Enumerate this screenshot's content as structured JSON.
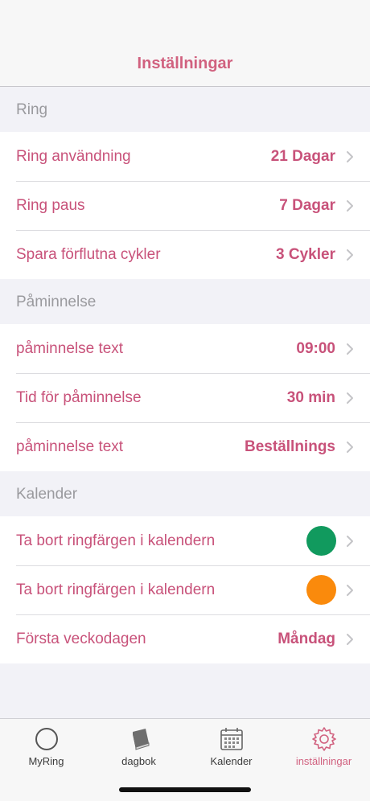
{
  "nav": {
    "title": "Inställningar"
  },
  "sections": {
    "ring": {
      "header": "Ring",
      "rows": [
        {
          "label": "Ring användning",
          "value": "21 Dagar"
        },
        {
          "label": "Ring paus",
          "value": "7 Dagar"
        },
        {
          "label": "Spara förflutna cykler",
          "value": "3 Cykler"
        }
      ]
    },
    "reminder": {
      "header": "Påminnelse",
      "rows": [
        {
          "label": "påminnelse text",
          "value": "09:00"
        },
        {
          "label": "Tid för påminnelse",
          "value": "30 min"
        },
        {
          "label": "påminnelse text",
          "value": "Beställnings"
        }
      ]
    },
    "calendar": {
      "header": "Kalender",
      "rows": [
        {
          "label": "Ta bort ringfärgen i kalendern",
          "color": "#119a5e"
        },
        {
          "label": "Ta bort ringfärgen i kalendern",
          "color": "#fa8a0c"
        },
        {
          "label": "Första veckodagen",
          "value": "Måndag"
        }
      ]
    }
  },
  "tabbar": {
    "tabs": [
      {
        "label": "MyRing",
        "icon": "ring-icon"
      },
      {
        "label": "dagbok",
        "icon": "book-icon"
      },
      {
        "label": "Kalender",
        "icon": "calendar-icon"
      },
      {
        "label": "inställningar",
        "icon": "gear-icon",
        "active": true
      }
    ]
  },
  "colors": {
    "accent": "#d1617f",
    "label": "#c8527a",
    "header": "#9a9a9e",
    "background": "#f2f2f7"
  }
}
